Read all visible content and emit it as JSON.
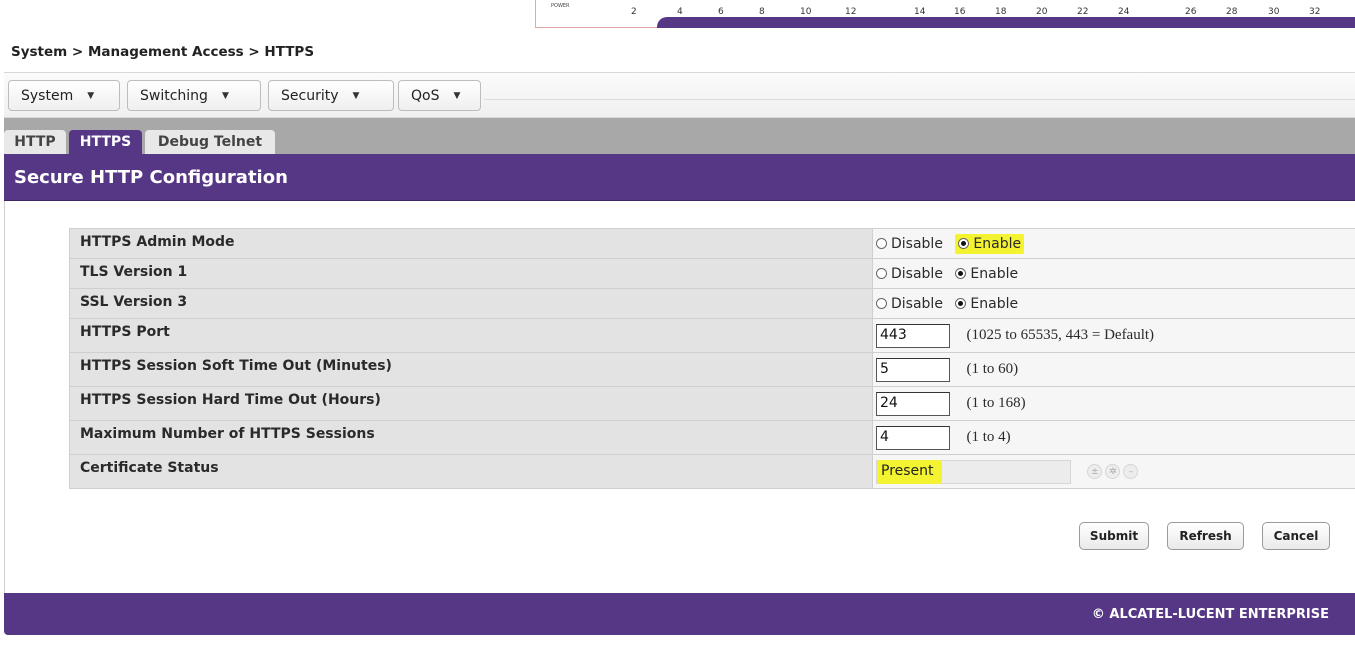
{
  "port_strip": {
    "power_label": "POWER",
    "ports": [
      "2",
      "4",
      "6",
      "8",
      "10",
      "12",
      "14",
      "16",
      "18",
      "20",
      "22",
      "24",
      "26",
      "28",
      "30",
      "32"
    ]
  },
  "breadcrumb": "System > Management Access > HTTPS",
  "menu": [
    {
      "label": "System"
    },
    {
      "label": "Switching"
    },
    {
      "label": "Security"
    },
    {
      "label": "QoS"
    }
  ],
  "tabs": [
    {
      "label": "HTTP",
      "active": false
    },
    {
      "label": "HTTPS",
      "active": true
    },
    {
      "label": "Debug Telnet",
      "active": false
    }
  ],
  "section_title": "Secure HTTP Configuration",
  "radio_labels": {
    "disable": "Disable",
    "enable": "Enable"
  },
  "settings": {
    "admin_mode": {
      "label": "HTTPS Admin Mode",
      "value": "Enable"
    },
    "tls_v1": {
      "label": "TLS Version 1",
      "value": "Enable"
    },
    "ssl_v3": {
      "label": "SSL Version 3",
      "value": "Enable"
    },
    "port": {
      "label": "HTTPS Port",
      "value": "443",
      "hint": "(1025 to 65535, 443 = Default)"
    },
    "soft_timeout": {
      "label": "HTTPS Session Soft Time Out  (Minutes)",
      "value": "5",
      "hint": "(1 to 60)"
    },
    "hard_timeout": {
      "label": "HTTPS Session Hard Time Out  (Hours)",
      "value": "24",
      "hint": "(1 to 168)"
    },
    "max_sessions": {
      "label": "Maximum Number of HTTPS Sessions",
      "value": "4",
      "hint": "(1 to 4)"
    },
    "cert_status": {
      "label": "Certificate Status",
      "value": "Present"
    }
  },
  "buttons": {
    "submit": "Submit",
    "refresh": "Refresh",
    "cancel": "Cancel"
  },
  "footer": "© ALCATEL-LUCENT ENTERPRISE",
  "colors": {
    "brand_purple": "#553786",
    "highlight_yellow": "#f3f331"
  }
}
